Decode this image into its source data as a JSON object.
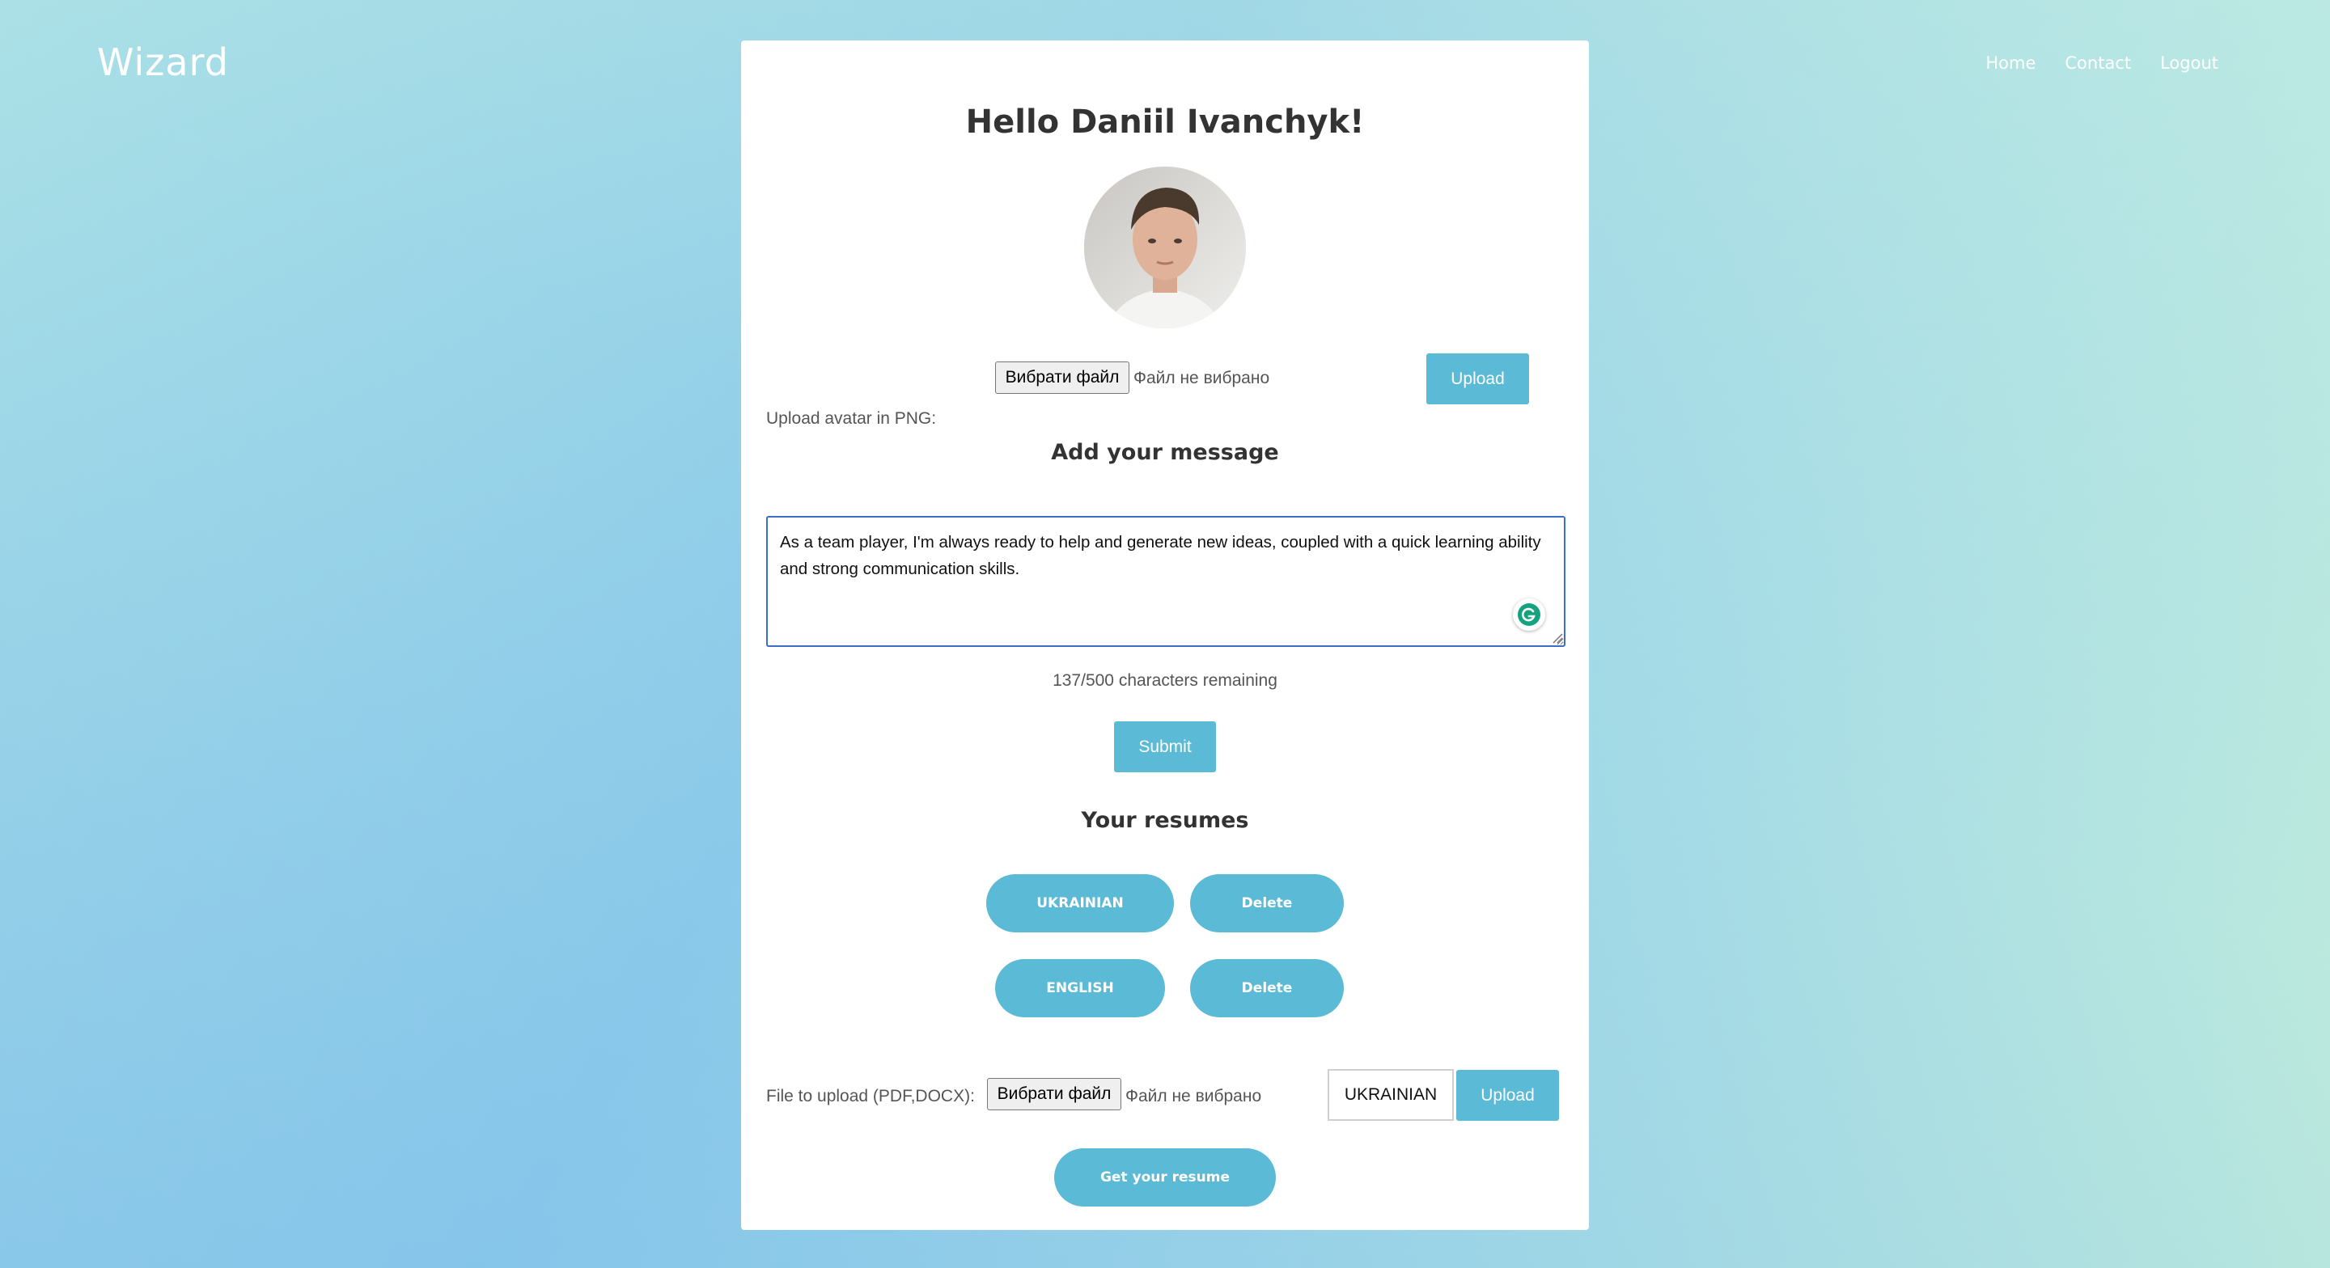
{
  "header": {
    "brand": "Wizard",
    "nav": [
      "Home",
      "Contact",
      "Logout"
    ]
  },
  "profile": {
    "greeting": "Hello Daniil Ivanchyk!",
    "avatar_label": "Upload avatar in PNG:",
    "choose_file_label": "Вибрати файл",
    "no_file_label": "Файл не вибрано",
    "upload_label": "Upload"
  },
  "message": {
    "title": "Add your message",
    "text": "As a team player, I'm always ready to help and generate new ideas, coupled with a quick learning ability and strong communication skills.",
    "counter": "137/500 characters remaining",
    "submit_label": "Submit"
  },
  "resumes": {
    "title": "Your resumes",
    "items": [
      {
        "language": "UKRAINIAN",
        "delete_label": "Delete"
      },
      {
        "language": "ENGLISH",
        "delete_label": "Delete"
      }
    ],
    "file_label": "File to upload (PDF,DOCX):",
    "choose_file_label": "Вибрати файл",
    "no_file_label": "Файл не вибрано",
    "language_value": "UKRAINIAN",
    "upload_label": "Upload",
    "get_resume_label": "Get your resume"
  },
  "colors": {
    "accent": "#5bbad5",
    "card": "#ffffff",
    "focus_border": "#3a6fc9"
  }
}
